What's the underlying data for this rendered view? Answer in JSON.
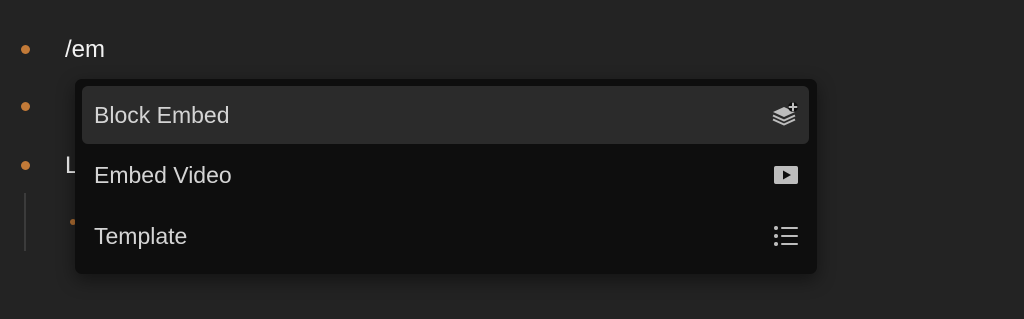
{
  "editor": {
    "blocks": [
      {
        "text": "/em"
      },
      {
        "text": ""
      },
      {
        "text": "L"
      }
    ]
  },
  "slash_menu": {
    "items": [
      {
        "label": "Block Embed",
        "icon": "block-embed-icon",
        "active": true
      },
      {
        "label": "Embed Video",
        "icon": "play-video-icon",
        "active": false
      },
      {
        "label": "Template",
        "icon": "list-icon",
        "active": false
      }
    ]
  },
  "colors": {
    "background": "#232323",
    "bullet": "#c27a38",
    "menu_background": "#0e0e0e",
    "menu_active": "#2b2b2b",
    "menu_text": "#d4d4d4"
  }
}
